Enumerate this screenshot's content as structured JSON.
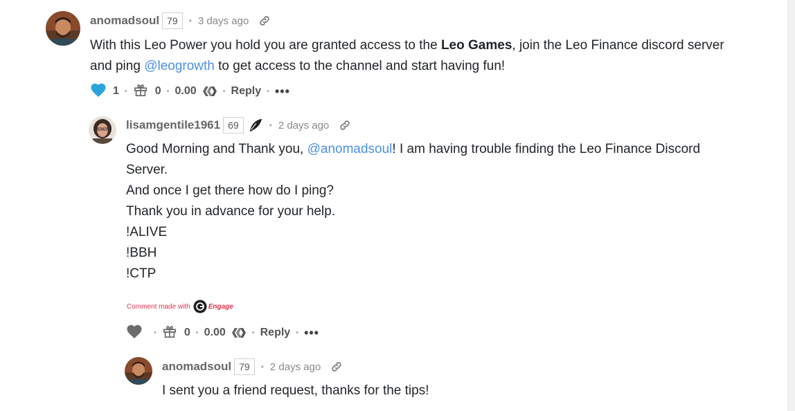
{
  "comments": [
    {
      "author": "anomadsoul",
      "reputation": "79",
      "time": "3 days ago",
      "body": {
        "line1_a": "With this Leo Power you hold you are granted access to the ",
        "line1_bold": "Leo Games",
        "line1_b": ", join the Leo Finance discord server",
        "line2_a": "and ping ",
        "line2_mention": "@leogrowth",
        "line2_b": " to get access to the channel and start having fun!"
      },
      "votes": "1",
      "gifts": "0",
      "payout": "0.00",
      "reply_label": "Reply",
      "more_label": "•••",
      "heart_color": "#2aa4dc"
    },
    {
      "author": "lisamgentile1961",
      "reputation": "69",
      "time": "2 days ago",
      "body": {
        "line1_a": "Good Morning and Thank you, ",
        "line1_mention": "@anomadsoul",
        "line1_b": "! I am having trouble finding the Leo Finance Discord",
        "line2": "Server.",
        "line3": "And once I get there how do I ping?",
        "line4": "Thank you in advance for your help.",
        "line5": "!ALIVE",
        "line6": "!BBH",
        "line7": "!CTP"
      },
      "engage_prefix": "Comment made with",
      "engage_brand": "Engage",
      "gifts": "0",
      "payout": "0.00",
      "reply_label": "Reply",
      "more_label": "•••",
      "heart_color": "#6b6b6b"
    },
    {
      "author": "anomadsoul",
      "reputation": "79",
      "time": "2 days ago",
      "body": {
        "line1": "I sent you a friend request, thanks for the tips!"
      }
    }
  ],
  "colors": {
    "mention": "#4a90e2",
    "engage": "#e0334d"
  },
  "icons": [
    "heart-icon",
    "gift-icon",
    "hive-icon",
    "link-icon",
    "quill-icon",
    "engage-logo-icon",
    "more-icon"
  ]
}
